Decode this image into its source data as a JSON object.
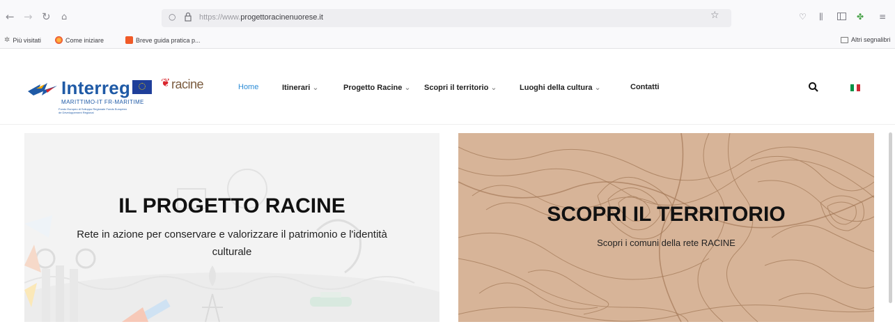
{
  "browser": {
    "url_prefix": "https://www.",
    "url_domain": "progettoracinenuorese.it",
    "bookmarks": [
      "Più visitati",
      "Come iniziare",
      "Breve guida pratica p..."
    ],
    "other_bookmarks": "Altri segnalibri"
  },
  "header": {
    "logo_text": "Interreg",
    "logo_sub": "MARITTIMO-IT FR-MARITIME",
    "logo_tiny": "Fondo Europeo di Sviluppo Regionale Fonds Européen de Développement Régional",
    "racine_logo": "racine",
    "menu": [
      {
        "label": "Home",
        "caret": ""
      },
      {
        "label": "Itinerari",
        "caret": "⌄"
      },
      {
        "label": "Progetto Racine",
        "caret": "⌄"
      },
      {
        "label": "Scopri il territorio",
        "caret": "⌄"
      },
      {
        "label": "Luoghi della cultura",
        "caret": "⌄"
      },
      {
        "label": "Contatti",
        "caret": ""
      }
    ]
  },
  "panels": {
    "left": {
      "title": "IL PROGETTO RACINE",
      "subtitle_line1": "Rete in azione per conservare e valorizzare il patrimonio e l'identità",
      "subtitle_line2": "culturale"
    },
    "right": {
      "title": "SCOPRI IL TERRITORIO",
      "subtitle": "Scopri i comuni della rete RACINE"
    }
  },
  "colors": {
    "menu_active": "#2c8cd6",
    "brand_blue": "#1f5aa6",
    "map_bg": "#d6b396",
    "map_lines": "#a77e5d"
  },
  "icons": [
    "back-icon",
    "forward-icon",
    "reload-icon",
    "home-icon",
    "shield-icon",
    "lock-icon",
    "star-icon",
    "pocket-icon",
    "library-icon",
    "sidebar-icon",
    "extension-icon",
    "menu-icon",
    "search-icon",
    "italian-flag-icon"
  ]
}
